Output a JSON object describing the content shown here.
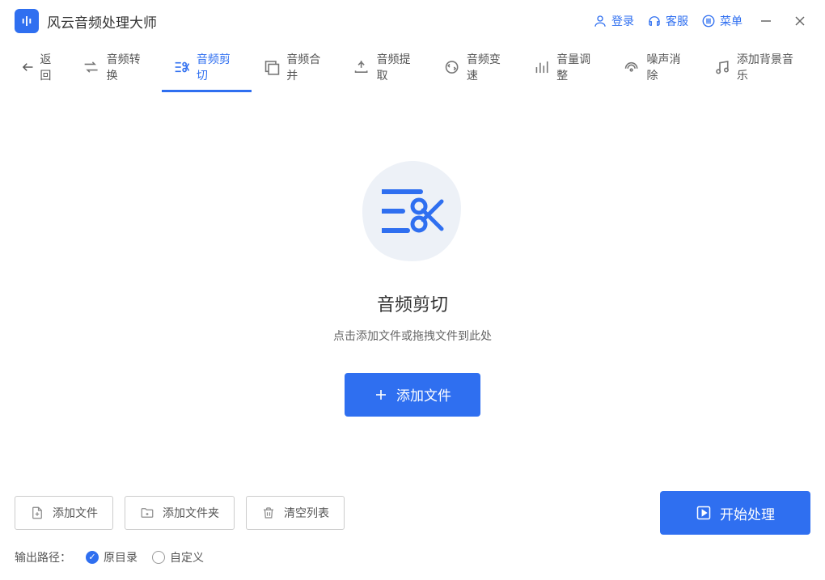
{
  "app": {
    "title": "风云音频处理大师"
  },
  "titlebar": {
    "login": "登录",
    "service": "客服",
    "menu": "菜单"
  },
  "tabs": {
    "back": "返回",
    "items": [
      {
        "label": "音频转换"
      },
      {
        "label": "音频剪切"
      },
      {
        "label": "音频合并"
      },
      {
        "label": "音频提取"
      },
      {
        "label": "音频变速"
      },
      {
        "label": "音量调整"
      },
      {
        "label": "噪声消除"
      },
      {
        "label": "添加背景音乐"
      }
    ],
    "activeIndex": 1
  },
  "main": {
    "title": "音频剪切",
    "subtitle": "点击添加文件或拖拽文件到此处",
    "addButton": "添加文件"
  },
  "bottom": {
    "addFile": "添加文件",
    "addFolder": "添加文件夹",
    "clearList": "清空列表",
    "start": "开始处理",
    "outputLabel": "输出路径：",
    "radioOriginal": "原目录",
    "radioCustom": "自定义",
    "selected": "original"
  }
}
